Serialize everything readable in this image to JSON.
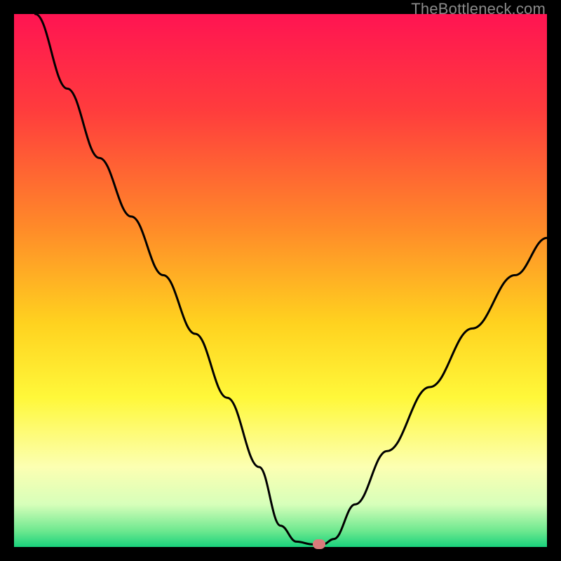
{
  "watermark": "TheBottleneck.com",
  "marker_color": "#d97b7b",
  "chart_data": {
    "type": "line",
    "title": "",
    "xlabel": "",
    "ylabel": "",
    "xlim": [
      0,
      100
    ],
    "ylim": [
      0,
      100
    ],
    "gradient_stops": [
      {
        "offset": 0,
        "color": "#ff1452"
      },
      {
        "offset": 18,
        "color": "#ff3c3d"
      },
      {
        "offset": 40,
        "color": "#ff8a29"
      },
      {
        "offset": 58,
        "color": "#ffd21f"
      },
      {
        "offset": 72,
        "color": "#fff83a"
      },
      {
        "offset": 85,
        "color": "#fcffb2"
      },
      {
        "offset": 92,
        "color": "#d7ffba"
      },
      {
        "offset": 97,
        "color": "#6de88f"
      },
      {
        "offset": 100,
        "color": "#19d27c"
      }
    ],
    "series": [
      {
        "name": "bottleneck-curve",
        "points": [
          {
            "x": 4,
            "y": 100
          },
          {
            "x": 10,
            "y": 86
          },
          {
            "x": 16,
            "y": 73
          },
          {
            "x": 22,
            "y": 62
          },
          {
            "x": 28,
            "y": 51
          },
          {
            "x": 34,
            "y": 40
          },
          {
            "x": 40,
            "y": 28
          },
          {
            "x": 46,
            "y": 15
          },
          {
            "x": 50,
            "y": 4
          },
          {
            "x": 53,
            "y": 1
          },
          {
            "x": 56,
            "y": 0.5
          },
          {
            "x": 58,
            "y": 0.5
          },
          {
            "x": 60,
            "y": 1.5
          },
          {
            "x": 64,
            "y": 8
          },
          {
            "x": 70,
            "y": 18
          },
          {
            "x": 78,
            "y": 30
          },
          {
            "x": 86,
            "y": 41
          },
          {
            "x": 94,
            "y": 51
          },
          {
            "x": 100,
            "y": 58
          }
        ]
      }
    ],
    "marker": {
      "x": 57.2,
      "y": 0.5
    }
  }
}
